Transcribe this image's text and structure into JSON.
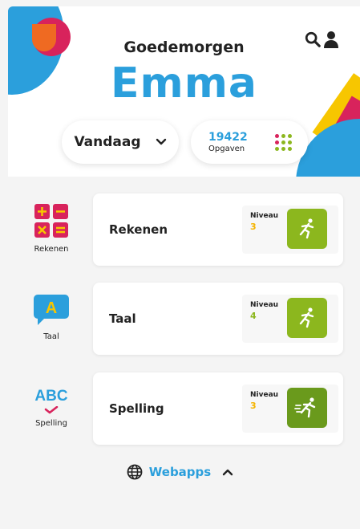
{
  "header": {
    "greeting": "Goedemorgen",
    "name": "Emma",
    "period_label": "Vandaag",
    "task_count": "19422",
    "task_label": "Opgaven"
  },
  "subjects": [
    {
      "icon_caption": "Rekenen",
      "title": "Rekenen",
      "level_label": "Niveau",
      "level": "3",
      "level_color": "#f5b400"
    },
    {
      "icon_caption": "Taal",
      "title": "Taal",
      "level_label": "Niveau",
      "level": "4",
      "level_color": "#8cb71e"
    },
    {
      "icon_caption": "Spelling",
      "icon_text": "ABC",
      "title": "Spelling",
      "level_label": "Niveau",
      "level": "3",
      "level_color": "#f5b400"
    }
  ],
  "footer": {
    "webapps_label": "Webapps"
  },
  "colors": {
    "primary_blue": "#2b9fdc",
    "accent_pink": "#d8235c",
    "accent_orange": "#ef6a22",
    "accent_yellow": "#f7c600",
    "play_green": "#8cb71e",
    "play_green_dark": "#6a9a1c"
  }
}
